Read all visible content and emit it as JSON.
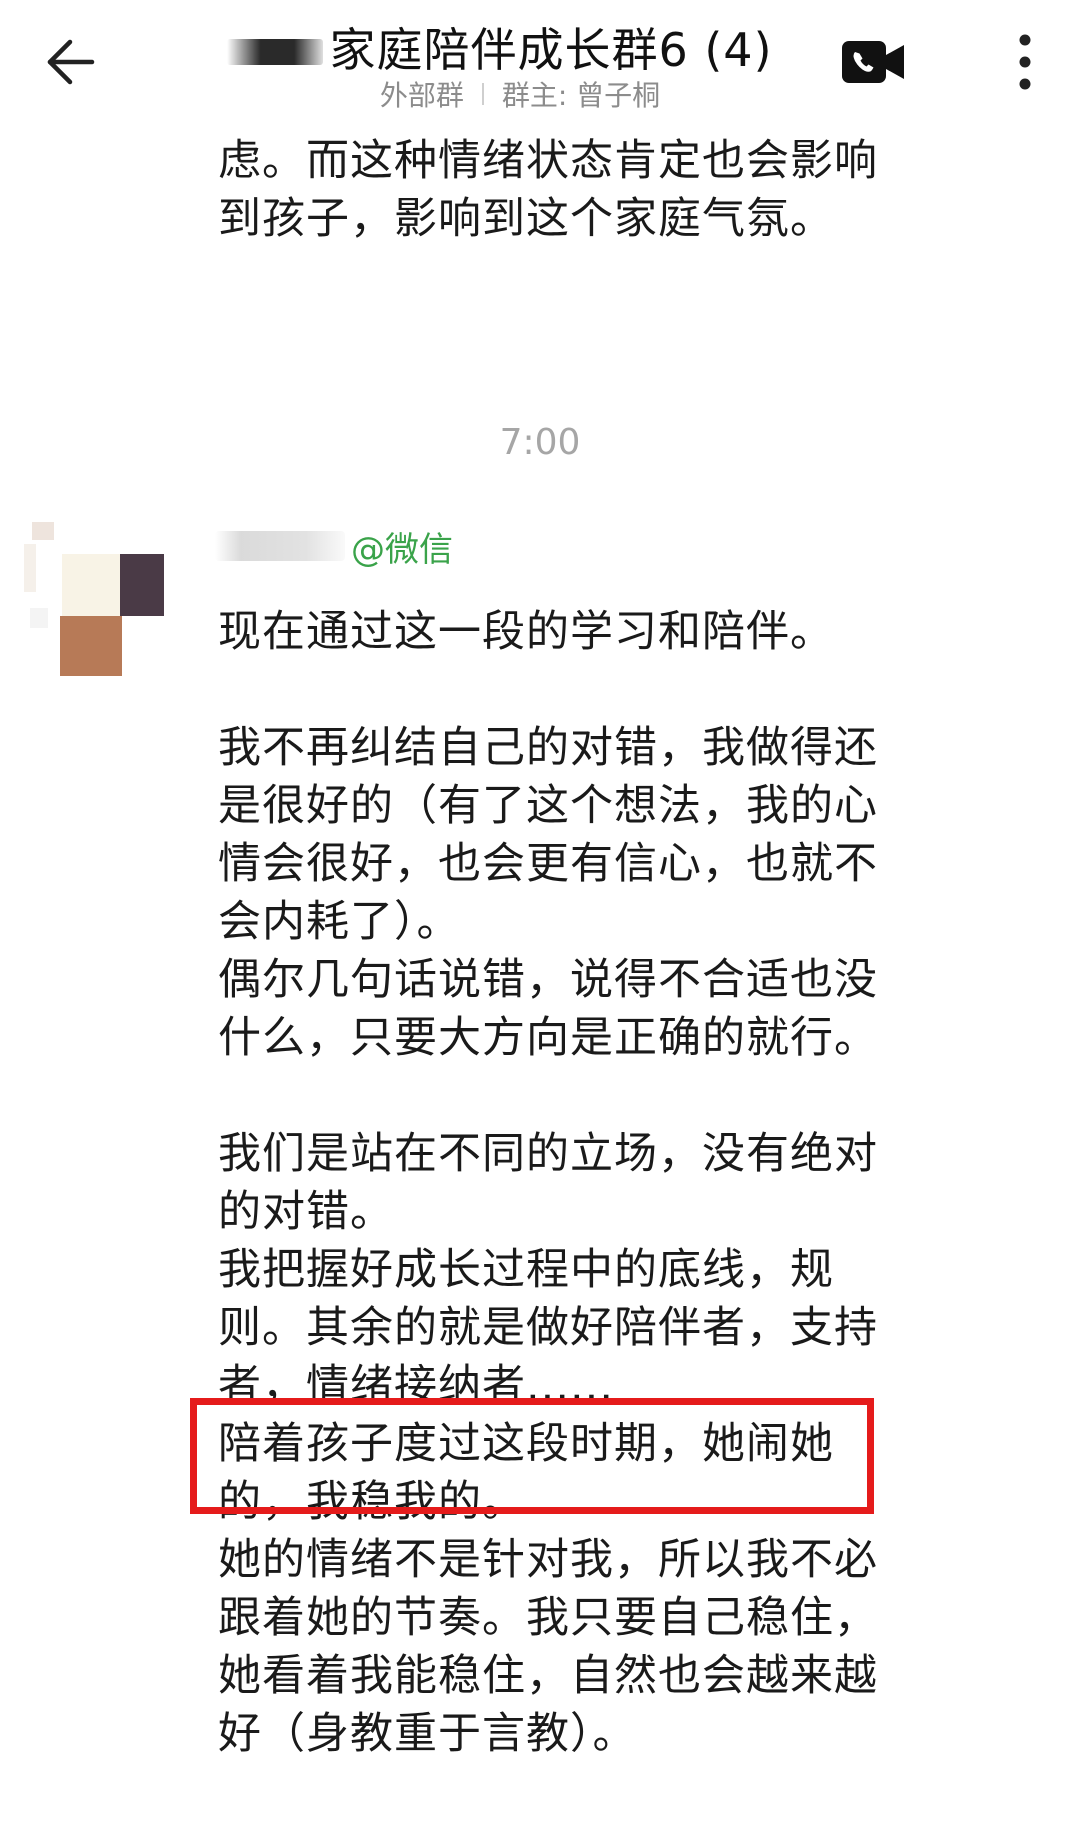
{
  "header": {
    "title": "家庭陪伴成长群6 (4)",
    "subtitle_left": "外部群",
    "subtitle_right": "群主: 曾子桐"
  },
  "messages": {
    "prev_text": "虑。而这种情绪状态肯定也会影响到孩子，影响到这个家庭气氛。",
    "timestamp": "7:00",
    "sender_suffix": "@微信",
    "lines": [
      "现在通过这一段的学习和陪伴。",
      "我不再纠结自己的对错，我做得还是很好的（有了这个想法，我的心情会很好，也会更有信心，也就不会内耗了）。",
      "偶尔几句话说错，说得不合适也没什么，只要大方向是正确的就行。",
      "我们是站在不同的立场，没有绝对的对错。",
      "我把握好成长过程中的底线，规则。其余的就是做好陪伴者，支持者，情绪接纳者......",
      "陪着孩子度过这段时期，她闹她的，我稳我的。",
      "她的情绪不是针对我，所以我不必跟着她的节奏。我只要自己稳住，她看着我能稳住，自然也会越来越好（身教重于言教）。"
    ]
  },
  "icons": {
    "back": "arrow-left-icon",
    "video": "video-call-icon",
    "more": "more-vertical-icon"
  },
  "colors": {
    "highlight_border": "#e51b1b",
    "sender_tag": "#3aa34a",
    "timestamp": "#a6a6a6",
    "subtitle": "#8c8c8c"
  }
}
